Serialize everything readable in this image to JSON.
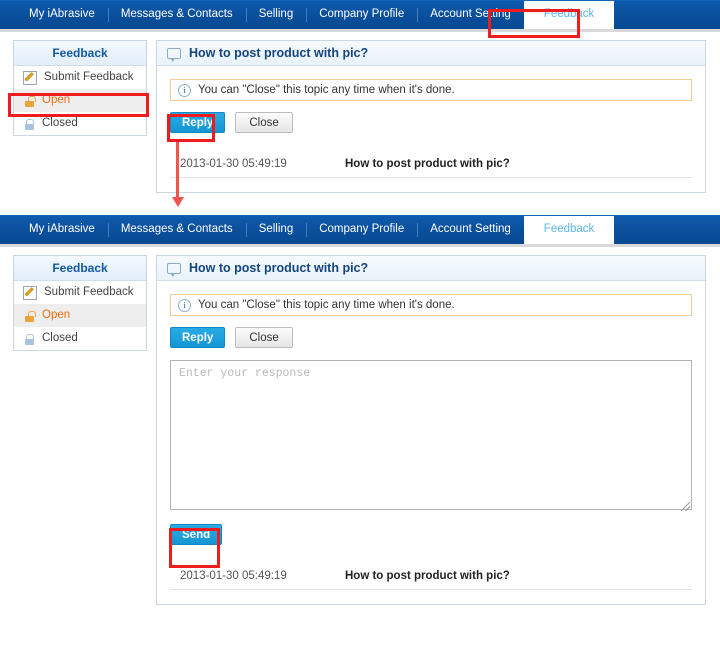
{
  "nav": {
    "items": [
      {
        "label": "My iAbrasive",
        "active": false
      },
      {
        "label": "Messages & Contacts",
        "active": false
      },
      {
        "label": "Selling",
        "active": false
      },
      {
        "label": "Company Profile",
        "active": false
      },
      {
        "label": "Account Setting",
        "active": false
      },
      {
        "label": "Feedback",
        "active": true
      }
    ]
  },
  "sidebar": {
    "title": "Feedback",
    "items": [
      {
        "label": "Submit Feedback",
        "icon": "pencil-icon",
        "selected": false
      },
      {
        "label": "Open",
        "icon": "lock-open-icon",
        "selected": true
      },
      {
        "label": "Closed",
        "icon": "lock-closed-icon",
        "selected": false
      }
    ]
  },
  "panel": {
    "icon": "speech-bubble-icon",
    "title": "How to post product with pic?",
    "notice": {
      "icon": "info-icon",
      "icon_glyph": "i",
      "text": "You can \"Close\" this topic any time when it's done."
    },
    "buttons": {
      "reply": "Reply",
      "close": "Close",
      "send": "Send"
    },
    "response": {
      "placeholder": "Enter your response",
      "value": ""
    },
    "message": {
      "date": "2013-01-30 05:49:19",
      "subject": "How to post product with pic?"
    }
  },
  "annotations": {
    "colors": {
      "highlight_box": "#ee1c1c",
      "arrow": "#f4524f"
    },
    "targets": [
      "feedback-tab",
      "sidebar-item-open",
      "reply-button",
      "send-button"
    ]
  },
  "colors": {
    "nav_background": "#0a52a1",
    "active_tab_text": "#5bb7ef",
    "primary_button": "#1496d4",
    "selected_item_text": "#ec6c0d",
    "panel_title": "#14457f",
    "sidebar_title": "#1159a6",
    "notice_border": "#f0ce9b"
  }
}
